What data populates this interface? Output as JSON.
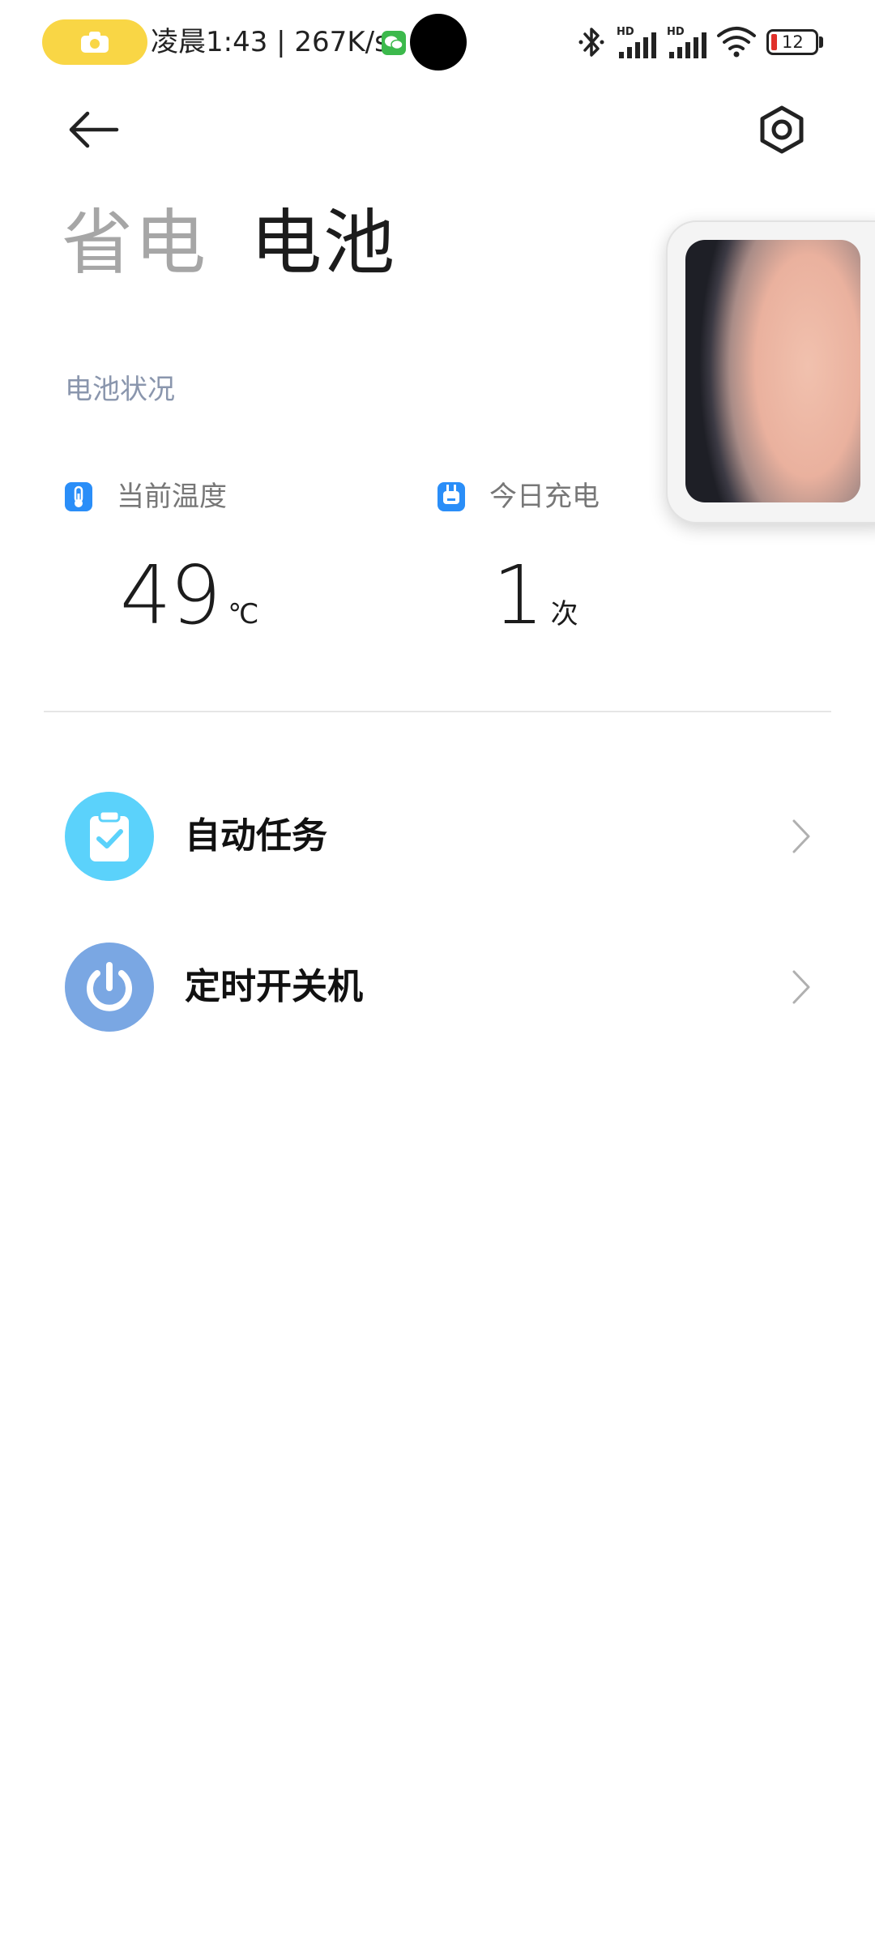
{
  "status_bar": {
    "time_speed": "凌晨1:43 | 267K/s",
    "battery_level": "12",
    "icons": [
      "camera-icon",
      "wechat-icon",
      "bluetooth-icon",
      "hd-signal-icon",
      "hd-signal-icon",
      "wifi-icon",
      "battery-icon"
    ]
  },
  "header": {
    "back_icon": "back-arrow-icon",
    "settings_icon": "settings-gear-icon"
  },
  "tabs": [
    {
      "label": "省电",
      "active": false
    },
    {
      "label": "电池",
      "active": true
    }
  ],
  "battery_status": {
    "section_title": "电池状况",
    "temperature": {
      "label": "当前温度",
      "value": "49",
      "unit": "℃",
      "icon": "thermometer-icon"
    },
    "charge_today": {
      "label": "今日充电",
      "value": "1",
      "unit": "次",
      "icon": "charger-plug-icon"
    }
  },
  "menu": [
    {
      "label": "自动任务",
      "icon": "clipboard-check-icon",
      "color": "#5bd2fb"
    },
    {
      "label": "定时开关机",
      "icon": "power-icon",
      "color": "#7aa7e3"
    }
  ],
  "colors": {
    "accent_blue": "#2a8ef8",
    "section_title": "#8a96ad",
    "camera_pill": "#f9d645",
    "battery_low": "#e0302a"
  }
}
